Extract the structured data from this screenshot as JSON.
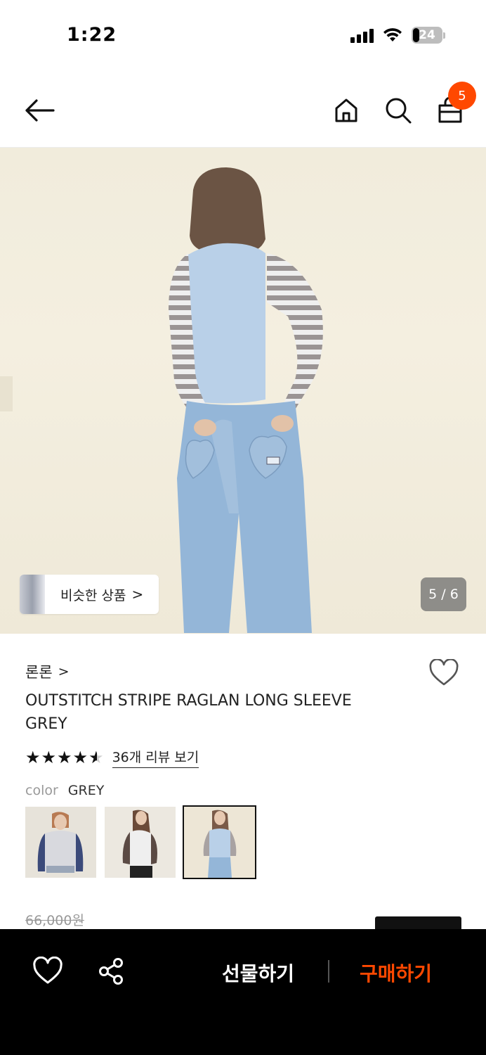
{
  "status_bar": {
    "time": "1:22",
    "battery_percent": "24",
    "icons": [
      "cellular-signal-icon",
      "wifi-icon",
      "battery-icon"
    ]
  },
  "header": {
    "icons": [
      "back-arrow-icon",
      "home-icon",
      "search-icon",
      "shopping-bag-icon"
    ],
    "cart_count": "5"
  },
  "hero": {
    "similar_products_label": "비슷한 상품",
    "similar_products_chevron": ">",
    "image_index": "5 / 6"
  },
  "product": {
    "brand": "론론",
    "brand_chevron": ">",
    "title": "OUTSTITCH STRIPE RAGLAN LONG SLEEVE GREY",
    "rating": 4.5,
    "review_link": "36개 리뷰 보기",
    "color_label": "color",
    "color_value": "GREY",
    "color_options_count": 3,
    "selected_color_index": 2,
    "original_price": "66,000원"
  },
  "bottom_bar": {
    "gift_label": "선물하기",
    "buy_label": "구매하기",
    "icons": [
      "heart-icon",
      "share-icon"
    ]
  },
  "colors": {
    "accent": "#ff4800",
    "bottom_bar_bg": "#000000",
    "text": "#222222",
    "muted": "#999999"
  }
}
